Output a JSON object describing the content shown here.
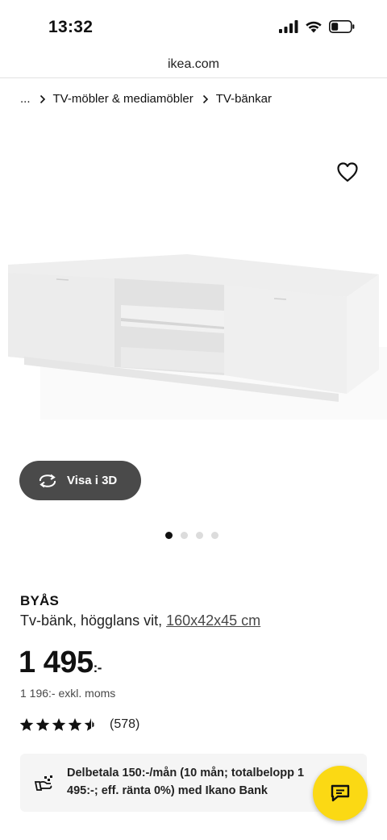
{
  "status_bar": {
    "time": "13:32",
    "icons": [
      "cellular-signal-icon",
      "wifi-icon",
      "battery-icon"
    ]
  },
  "browser": {
    "url": "ikea.com"
  },
  "breadcrumb": {
    "ellipsis": "...",
    "items": [
      "TV-möbler & mediamöbler",
      "TV-bänkar"
    ],
    "separator_icon": "chevron-right-icon"
  },
  "gallery": {
    "favorite_icon": "heart-icon",
    "view_3d_label": "Visa i 3D",
    "view_3d_icon": "rotate-icon",
    "page_count": 4,
    "active_page": 1
  },
  "product": {
    "name": "BYÅS",
    "description": "Tv-bänk, högglans vit,",
    "dimensions": "160x42x45 cm",
    "price": "1 495",
    "price_suffix": ":-",
    "price_ex_vat": "1 196:- exkl. moms",
    "rating": 4.5,
    "review_count": "(578)"
  },
  "finance": {
    "text": "Delbetala 150:-/mån (10 mån; totalbelopp 1 495:-; eff. ränta 0%) med Ikano Bank",
    "icon": "payment-icon"
  },
  "chat": {
    "icon": "chat-icon"
  },
  "colors": {
    "accent_yellow": "#fbd914",
    "button_dark": "#4a4a4a",
    "text": "#111111"
  }
}
